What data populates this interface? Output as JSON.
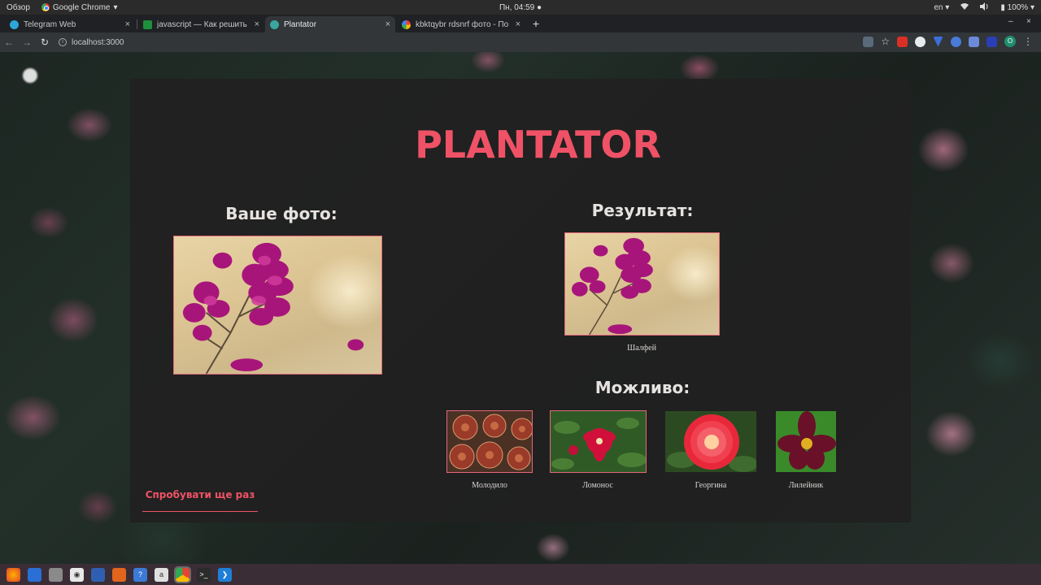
{
  "system_bar": {
    "activities": "Обзор",
    "app_name": "Google Chrome",
    "clock": "Пн, 04:59",
    "lang": "en",
    "battery": "100%"
  },
  "tabs": [
    {
      "title": "Telegram Web",
      "icon": "telegram-icon",
      "color": "#2ea6da",
      "active": false
    },
    {
      "title": "javascript — Как решить",
      "icon": "stackexchange-icon",
      "color": "#1e8f3b",
      "active": false
    },
    {
      "title": "Plantator",
      "icon": "plantator-favicon-icon",
      "color": "#3aa6a0",
      "active": true
    },
    {
      "title": "kbktqybr rdsnrf фото - По",
      "icon": "google-icon",
      "color": "#4285f4",
      "active": false
    }
  ],
  "toolbar": {
    "url": "localhost:3000",
    "profile_letter": "O"
  },
  "page": {
    "brand": "PLANTATOR",
    "your_photo_heading": "Ваше фото:",
    "result_heading": "Результат:",
    "result_caption": "Шалфей",
    "maybe_heading": "Можливо:",
    "suggestions": [
      {
        "label": "Молодило",
        "icon": "sempervivum-thumbnail"
      },
      {
        "label": "Ломонос",
        "icon": "clematis-thumbnail"
      },
      {
        "label": "Георгина",
        "icon": "dahlia-thumbnail"
      },
      {
        "label": "Лилейник",
        "icon": "daylily-thumbnail"
      }
    ],
    "retry_button": "Спробувати ще раз"
  },
  "colors": {
    "accent": "#ef5266",
    "panel_bg": "#202020",
    "heading_text": "#e6e2e0"
  }
}
